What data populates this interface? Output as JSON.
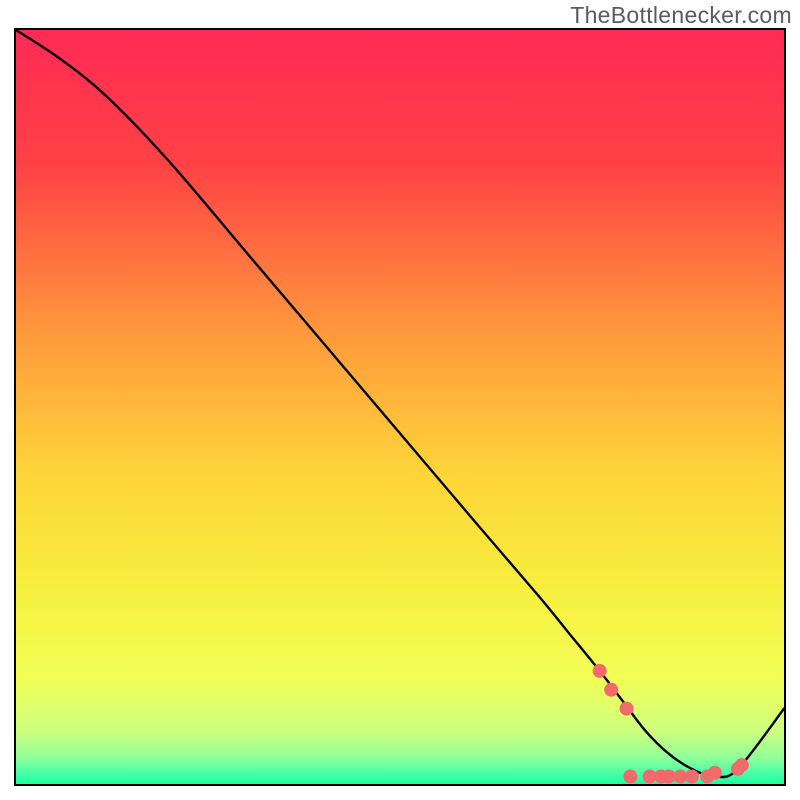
{
  "watermark": {
    "text": "TheBottlenecker.com"
  },
  "chart_data": {
    "type": "line",
    "title": "",
    "xlabel": "",
    "ylabel": "",
    "xlim": [
      0,
      100
    ],
    "ylim": [
      0,
      100
    ],
    "grid": false,
    "legend": null,
    "gradient_stops": [
      {
        "offset": 0,
        "color": "#ff2a55"
      },
      {
        "offset": 0.18,
        "color": "#ff4246"
      },
      {
        "offset": 0.4,
        "color": "#ff983c"
      },
      {
        "offset": 0.58,
        "color": "#ffd23a"
      },
      {
        "offset": 0.74,
        "color": "#f7ef3e"
      },
      {
        "offset": 0.86,
        "color": "#f2ff56"
      },
      {
        "offset": 0.93,
        "color": "#ceff7e"
      },
      {
        "offset": 0.965,
        "color": "#90ff9a"
      },
      {
        "offset": 0.985,
        "color": "#4bffa8"
      },
      {
        "offset": 1.0,
        "color": "#1cff9e"
      }
    ],
    "series": [
      {
        "name": "bottleneck-curve",
        "x": [
          0,
          6,
          12,
          20,
          30,
          40,
          50,
          60,
          68,
          72,
          76,
          79,
          82,
          85,
          88,
          91,
          94,
          100
        ],
        "y": [
          100,
          96,
          91,
          82.5,
          70.5,
          58.5,
          46.5,
          34.5,
          25,
          20,
          15,
          11,
          7,
          4,
          2,
          1,
          2,
          10
        ]
      }
    ],
    "highlight_points": {
      "name": "sweet-spot-dots",
      "color": "#f26a6a",
      "radius": 7,
      "points": [
        {
          "x": 76,
          "y": 15.0
        },
        {
          "x": 77.5,
          "y": 12.5
        },
        {
          "x": 79.5,
          "y": 10.0
        },
        {
          "x": 80,
          "y": 1.0
        },
        {
          "x": 82.5,
          "y": 1.0
        },
        {
          "x": 84,
          "y": 1.0
        },
        {
          "x": 85,
          "y": 1.0
        },
        {
          "x": 86.5,
          "y": 1.0
        },
        {
          "x": 88,
          "y": 1.0
        },
        {
          "x": 90,
          "y": 1.0
        },
        {
          "x": 91,
          "y": 1.5
        },
        {
          "x": 94,
          "y": 2.0
        },
        {
          "x": 94.5,
          "y": 2.5
        }
      ]
    }
  }
}
